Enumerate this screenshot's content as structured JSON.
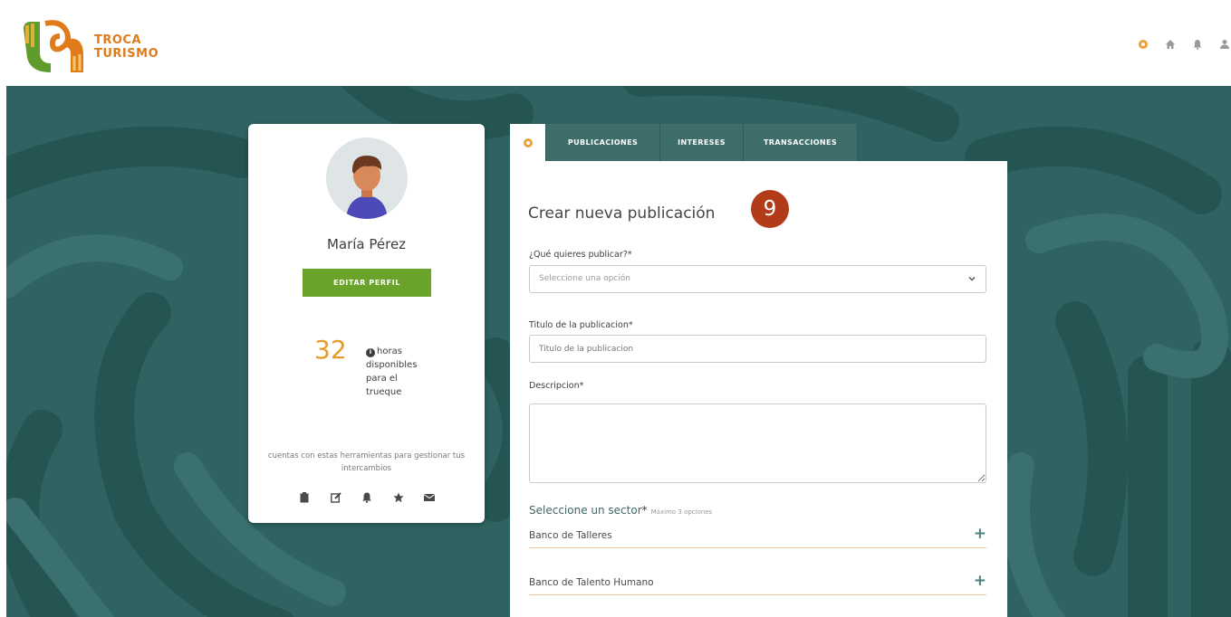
{
  "brand": {
    "line1": "TROCA",
    "line2": "TURISMO"
  },
  "header_icons": [
    "gear-icon",
    "home-icon",
    "bell-icon",
    "user-icon"
  ],
  "profile": {
    "name": "María Pérez",
    "edit_label": "EDITAR PERFIL",
    "hours_value": "32",
    "hours_text_1": "horas",
    "hours_text_2": "disponibles",
    "hours_text_3": "para el",
    "hours_text_4": "trueque",
    "tools_text": "cuentas con estas herramientas para gestionar tus intercambios",
    "tool_icons": [
      "clipboard-icon",
      "edit-icon",
      "bell-icon",
      "star-icon",
      "envelope-icon"
    ]
  },
  "tabs": [
    {
      "label": "PUBLICACIONES"
    },
    {
      "label": "INTERESES"
    },
    {
      "label": "TRANSACCIONES"
    }
  ],
  "form": {
    "title": "Crear nueva publicación",
    "step_number": "9",
    "what_label": "¿Qué quieres publicar?*",
    "what_placeholder": "Seleccione una opción",
    "title_label": "Titulo de la publicacion*",
    "title_placeholder": "Titulo de la publicacion",
    "description_label": "Descripcion*",
    "sector_title": "Seleccione un sector",
    "sector_req": "*",
    "sector_hint": "Máximo 3 opciones",
    "sectors": [
      {
        "label": "Banco de Talleres"
      },
      {
        "label": "Banco de Talento Humano"
      }
    ]
  },
  "colors": {
    "brand_orange": "#e07b1c",
    "teal_bg": "#2e6361",
    "tab_teal": "#3d6e6c",
    "edit_green": "#6aa32a",
    "hours_orange": "#e99a22",
    "step_badge": "#b23b1a"
  }
}
